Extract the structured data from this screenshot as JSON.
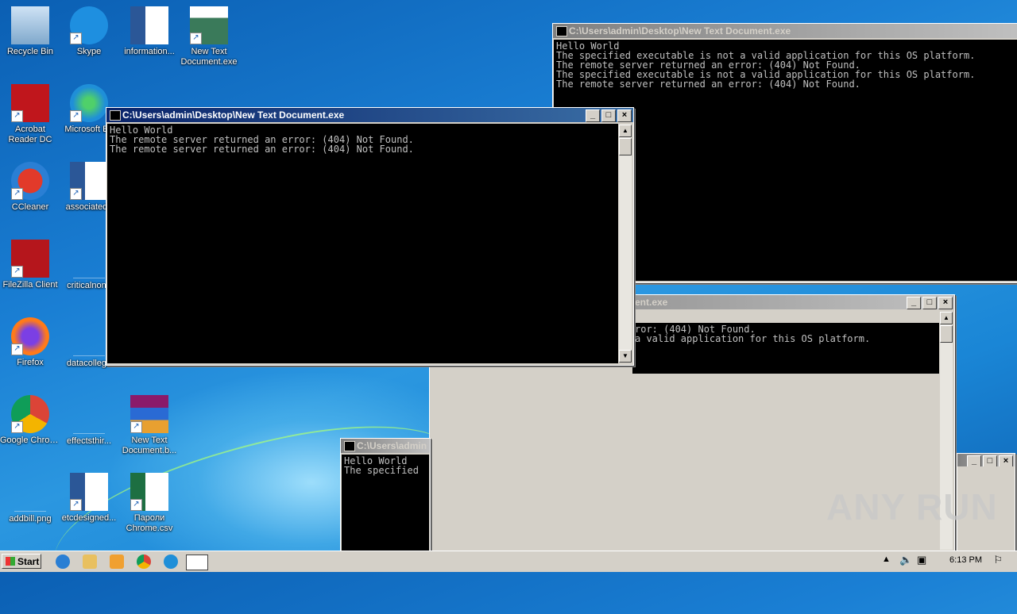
{
  "desktop_icons": [
    {
      "name": "recycle-bin",
      "label": "Recycle Bin",
      "icon": "recycle-bin-icon"
    },
    {
      "name": "skype",
      "label": "Skype",
      "icon": "skype-icon"
    },
    {
      "name": "information",
      "label": "information...",
      "icon": "word-document-icon"
    },
    {
      "name": "new-text-document-exe",
      "label": "New Text Document.exe",
      "icon": "exe-window-icon"
    },
    {
      "name": "acrobat-reader",
      "label": "Acrobat Reader DC",
      "icon": "acrobat-icon"
    },
    {
      "name": "microsoft-edge",
      "label": "Microsoft Ed",
      "icon": "edge-icon"
    },
    {
      "name": "ccleaner",
      "label": "CCleaner",
      "icon": "ccleaner-icon"
    },
    {
      "name": "associateda",
      "label": "associateda",
      "icon": "word-document-icon"
    },
    {
      "name": "filezilla",
      "label": "FileZilla Client",
      "icon": "filezilla-icon"
    },
    {
      "name": "criticalnone",
      "label": "criticalnone",
      "icon": "blank-file-icon"
    },
    {
      "name": "firefox",
      "label": "Firefox",
      "icon": "firefox-icon"
    },
    {
      "name": "datacollege",
      "label": "datacollege",
      "icon": "blank-file-icon"
    },
    {
      "name": "google-chrome",
      "label": "Google Chrome",
      "icon": "chrome-icon"
    },
    {
      "name": "effectsthir",
      "label": "effectsthir...",
      "icon": "blank-file-icon"
    },
    {
      "name": "new-text-document-b",
      "label": "New Text Document.b...",
      "icon": "winrar-icon"
    },
    {
      "name": "addbill",
      "label": "addbill.png",
      "icon": "blank-file-icon"
    },
    {
      "name": "etcdesigned",
      "label": "etcdesigned...",
      "icon": "word-document-icon"
    },
    {
      "name": "paroli-chrome",
      "label": "Пароли Chrome.csv",
      "icon": "excel-csv-icon"
    }
  ],
  "windows": {
    "main": {
      "title": "C:\\Users\\admin\\Desktop\\New Text Document.exe",
      "output": "Hello World\nThe remote server returned an error: (404) Not Found.\nThe remote server returned an error: (404) Not Found."
    },
    "top_right": {
      "title": "C:\\Users\\admin\\Desktop\\New Text Document.exe",
      "output": "Hello World\nThe specified executable is not a valid application for this OS platform.\nThe remote server returned an error: (404) Not Found.\nThe specified executable is not a valid application for this OS platform.\nThe remote server returned an error: (404) Not Found."
    },
    "middle_right": {
      "title": "ent.exe",
      "output": "ror: (404) Not Found.\na valid application for this OS platform."
    },
    "bottom_small": {
      "title": "C:\\Users\\admin",
      "output": "Hello World\nThe specified"
    }
  },
  "taskbar": {
    "start_label": "Start",
    "clock": "6:13 PM",
    "quicklaunch": [
      "ie-icon",
      "explorer-icon",
      "media-player-icon",
      "chrome-icon",
      "edge-icon",
      "console-icon"
    ]
  },
  "watermark": "ANY RUN"
}
